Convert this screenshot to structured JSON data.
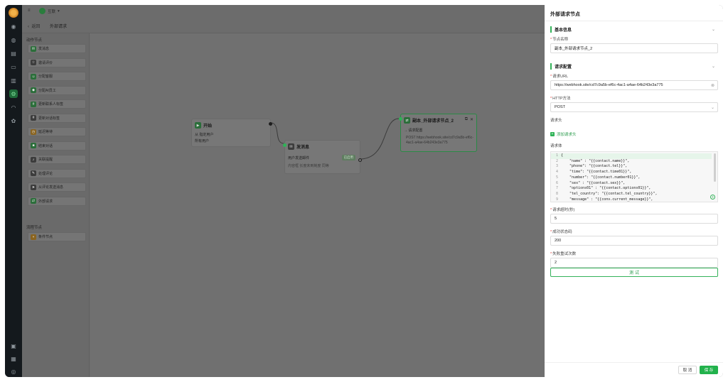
{
  "topbar": {
    "menu_icon": "menu-icon",
    "brand_name": "互联",
    "brand_chevron": "▾"
  },
  "subbar": {
    "back_label": "返回",
    "page_title": "外部请求"
  },
  "left_panel": {
    "section_actions": "动作节点",
    "actions": [
      {
        "label": "发消息",
        "icon": "message-icon",
        "tone": "green"
      },
      {
        "label": "邀请评价",
        "icon": "star-icon",
        "tone": "dark"
      },
      {
        "label": "分配客服",
        "icon": "user-icon",
        "tone": "green"
      },
      {
        "label": "分配AI员工",
        "icon": "robot-icon",
        "tone": "green"
      },
      {
        "label": "更新联系人标签",
        "icon": "tag-icon",
        "tone": "green"
      },
      {
        "label": "更新对话标签",
        "icon": "tag-icon",
        "tone": "dark"
      },
      {
        "label": "延迟等待",
        "icon": "clock-icon",
        "tone": "orange"
      },
      {
        "label": "结束对话",
        "icon": "stop-icon",
        "tone": "green"
      },
      {
        "label": "关联提醒",
        "icon": "bell-icon",
        "tone": "dark"
      },
      {
        "label": "处理评论",
        "icon": "comment-icon",
        "tone": "dark"
      },
      {
        "label": "从评论发送消息",
        "icon": "send-icon",
        "tone": "dark"
      },
      {
        "label": "外部请求",
        "icon": "link-icon",
        "tone": "green"
      }
    ],
    "section_flow": "流程节点",
    "flow": [
      {
        "label": "条件节点",
        "icon": "branch-icon",
        "tone": "orange"
      }
    ]
  },
  "canvas": {
    "start_node": {
      "title": "开始",
      "line1": "从 指定用户",
      "line2": "所有用户"
    },
    "send_node": {
      "title": "发消息",
      "badge": "已启用",
      "line1": "用户发送邮件",
      "line2": "内容框 长度未到制度 同等"
    },
    "request_node": {
      "title": "副本_外部请求节点_2",
      "line1": "请求配置",
      "line2": "POST https://webhook.site/cd7c9a5b-ef6c-4ac1-a4ae-64b243e3a775"
    }
  },
  "drawer": {
    "title": "外部请求节点",
    "basic_group": "基本信息",
    "name_label": "节点名称",
    "name_value": "副本_外部请求节点_2",
    "request_group": "请求配置",
    "url_label": "请求URL",
    "url_value": "https://webhook.site/cd7c9a5b-ef6c-4ac1-a4ae-64b243e3a775",
    "method_label": "HTTP方法",
    "method_value": "POST",
    "headers_label": "请求头",
    "add_header_label": "添加请求头",
    "body_label": "请求体",
    "body_lines": [
      {
        "n": "1",
        "t": "{"
      },
      {
        "n": "2",
        "t": "    \"name\" : \"{{contact.name}}\","
      },
      {
        "n": "3",
        "t": "    \"phone\": \"{{contact.tel}}\","
      },
      {
        "n": "4",
        "t": "    \"time\": \"{{contact.time01}}\","
      },
      {
        "n": "5",
        "t": "    \"number\": \"{{contact.number01}}\","
      },
      {
        "n": "6",
        "t": "    \"sex\" : \"{{contact.sex}}\","
      },
      {
        "n": "7",
        "t": "    \"options01\" : \"{{contact.options01}}\","
      },
      {
        "n": "8",
        "t": "    \"tel_country\": \"{{contact.tel_country}}\","
      },
      {
        "n": "9",
        "t": "    \"message\" : \"{{conv.current_message}}\","
      }
    ],
    "timeout_label": "请求超时(秒)",
    "timeout_value": "5",
    "status_label": "成功状态码",
    "status_value": "200",
    "retry_label": "失败重试次数",
    "retry_value": "2",
    "test_label": "测 试",
    "cancel_label": "取 消",
    "save_label": "保 存"
  },
  "colors": {
    "accent": "#22b24c",
    "rail": "#14191d",
    "overlay": "#6f6f6f"
  }
}
